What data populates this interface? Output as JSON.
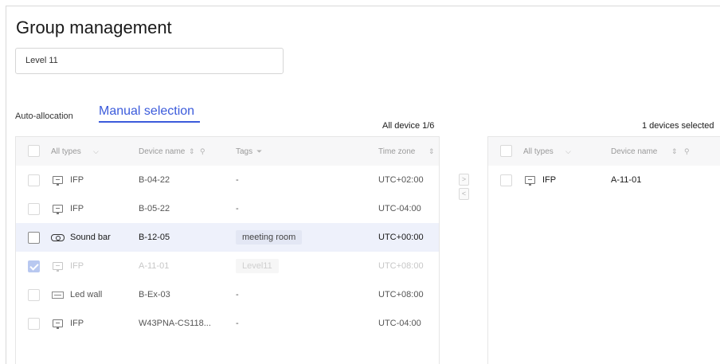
{
  "page": {
    "title": "Group management"
  },
  "group_name": {
    "value": "Level 11"
  },
  "tabs": [
    {
      "label": "Auto-allocation",
      "active": false
    },
    {
      "label": "Manual selection",
      "active": true
    }
  ],
  "left_panel": {
    "count_label": "All device 1/6",
    "columns": {
      "types": "All types",
      "device_name": "Device name",
      "tags": "Tags",
      "time_zone": "Time zone"
    },
    "rows": [
      {
        "icon": "ifp-icon",
        "type": "IFP",
        "name": "B-04-22",
        "tags": "-",
        "tz": "UTC+02:00",
        "state": "normal"
      },
      {
        "icon": "ifp-icon",
        "type": "IFP",
        "name": "B-05-22",
        "tags": "-",
        "tz": "UTC-04:00",
        "state": "normal"
      },
      {
        "icon": "sound-bar-icon",
        "type": "Sound bar",
        "name": "B-12-05",
        "tags": "meeting room",
        "tz": "UTC+00:00",
        "state": "highlight"
      },
      {
        "icon": "ifp-icon",
        "type": "IFP",
        "name": "A-11-01",
        "tags": "Level11",
        "tz": "UTC+08:00",
        "state": "disabled-checked"
      },
      {
        "icon": "led-wall-icon",
        "type": "Led wall",
        "name": "B-Ex-03",
        "tags": "-",
        "tz": "UTC+08:00",
        "state": "normal"
      },
      {
        "icon": "ifp-icon",
        "type": "IFP",
        "name": "W43PNA-CS118...",
        "tags": "-",
        "tz": "UTC-04:00",
        "state": "normal"
      }
    ]
  },
  "transfer": {
    "right_arrow": ">",
    "left_arrow": "<"
  },
  "right_panel": {
    "count_label": "1 devices selected",
    "columns": {
      "types": "All types",
      "device_name": "Device name"
    },
    "rows": [
      {
        "icon": "ifp-icon",
        "type": "IFP",
        "name": "A-11-01"
      }
    ]
  },
  "colors": {
    "accent": "#3b5bdb",
    "highlight_row": "#eef1fb",
    "header_bg": "#f7f7f8"
  }
}
